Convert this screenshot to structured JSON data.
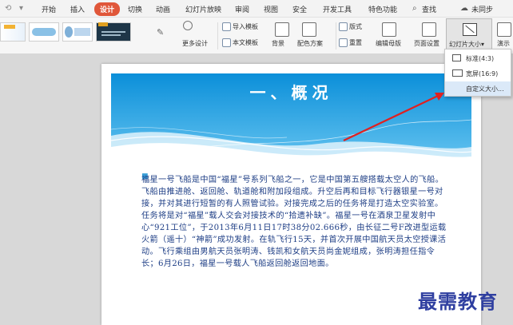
{
  "menubar": {
    "items": [
      "开始",
      "插入",
      "设计",
      "切换",
      "动画",
      "幻灯片放映",
      "审阅",
      "视图",
      "安全",
      "开发工具",
      "特色功能",
      "查找"
    ],
    "active": "设计",
    "sync_status": "未同步"
  },
  "ribbon": {
    "more_designs": "更多设计",
    "import_template": "导入模板",
    "text_template": "本文模板",
    "background": "背景",
    "color_scheme": "配色方案",
    "layout": "版式",
    "reset": "重置",
    "edit_master": "编辑母版",
    "page_setup": "页面设置",
    "slide_size": "幻灯片大小",
    "present": "演示"
  },
  "dropdown": {
    "standard": "标准(4:3)",
    "widescreen": "宽屏(16:9)",
    "custom": "自定义大小..."
  },
  "slide": {
    "title": "一、概况",
    "body": "福星一号飞船是中国“福星”号系列飞船之一，它是中国第五艘搭载太空人的飞船。飞船由推进舱、返回舱、轨道舱和附加段组成。升空后再和目标飞行器银星一号对接，并对其进行短暂的有人照管试验。对接完成之后的任务将是打造太空实验室。任务将是对“福星”载人交会对接技术的“拾遗补缺”。福星一号在酒泉卫星发射中心“921工位”，于2013年6月11日17时38分02.666秒，由长征二号F改进型运载火箭（遥十）“神箭”成功发射。在轨飞行15天，并首次开展中国航天员太空授课活动。飞行乘组由男航天员张明涛、钱凯和女航天员尚金妮组成，张明涛担任指令长；6月26日，福星一号载人飞船返回舱返回地面。"
  },
  "watermark": "最需教育",
  "colors": {
    "active_tab": "#e0573a",
    "banner_blue": "#1aa3e8",
    "body_text": "#1f3f86",
    "arrow": "#e02020"
  }
}
